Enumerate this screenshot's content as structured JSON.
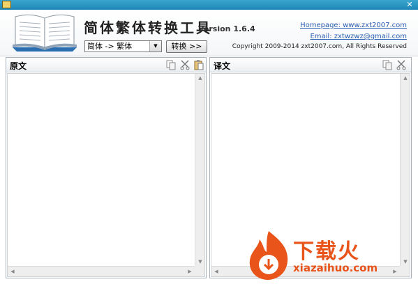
{
  "window": {
    "close_glyph": "✕"
  },
  "header": {
    "app_name": "简体繁体转换工具",
    "version": "Version 1.6.4",
    "direction_value": "简体 -> 繁体",
    "convert_label": "转换 >>",
    "homepage": "Homepage: www.zxt2007.com",
    "email": "Email: zxtwzwz@gmail.com",
    "copyright": "Copyright 2009-2014 zxt2007.com, All Rights Reserved"
  },
  "source_panel": {
    "title": "原文",
    "tools": [
      "copy-icon",
      "cut-icon",
      "paste-icon"
    ]
  },
  "target_panel": {
    "title": "译文",
    "tools": [
      "copy-icon",
      "cut-icon"
    ]
  },
  "watermark": {
    "text": "下载火",
    "domain": "xiazaihuo.com"
  },
  "colors": {
    "titlebar": "#2a95c4",
    "link": "#2a5db0",
    "watermark": "#e8541a"
  }
}
